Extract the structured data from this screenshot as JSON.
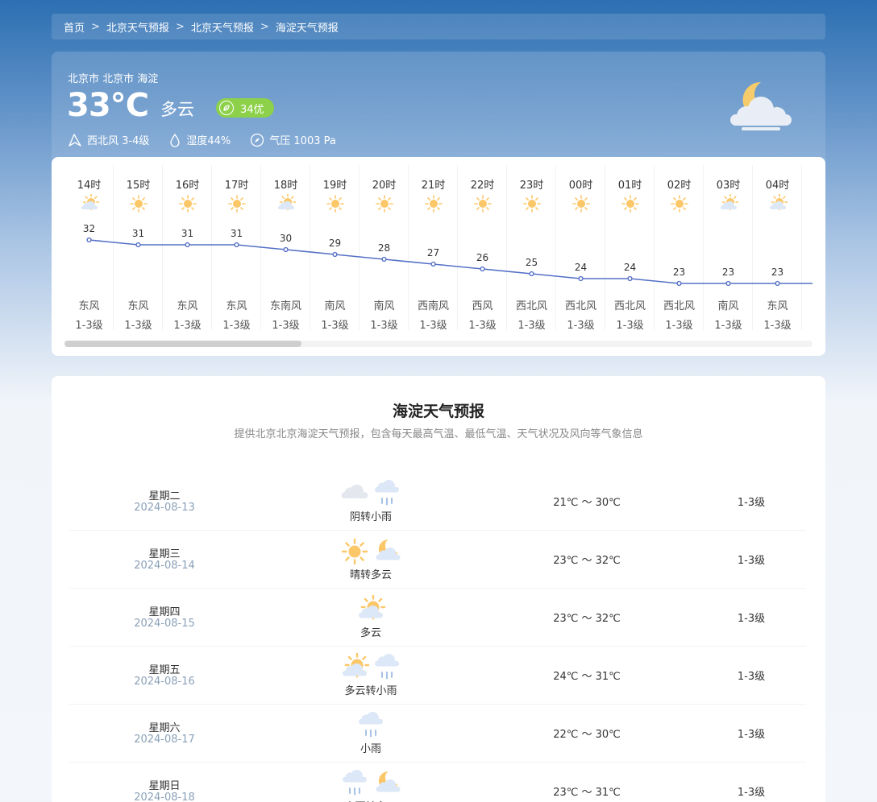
{
  "breadcrumb": [
    "首页",
    "北京天气预报",
    "北京天气预报",
    "海淀天气预报"
  ],
  "current": {
    "location": "北京市 北京市 海淀",
    "temperature": "33℃",
    "condition": "多云",
    "aqi": "34优",
    "wind": "西北风 3-4级",
    "humidity": "湿度44%",
    "pressure": "气压 1003 Pa",
    "icon": "moon-cloud-icon"
  },
  "hourly": [
    {
      "time": "14时",
      "icon": "sun-cloud",
      "temp": 32,
      "wind_dir": "东风",
      "wind_level": "1-3级"
    },
    {
      "time": "15时",
      "icon": "sun",
      "temp": 31,
      "wind_dir": "东风",
      "wind_level": "1-3级"
    },
    {
      "time": "16时",
      "icon": "sun",
      "temp": 31,
      "wind_dir": "东风",
      "wind_level": "1-3级"
    },
    {
      "time": "17时",
      "icon": "sun",
      "temp": 31,
      "wind_dir": "东风",
      "wind_level": "1-3级"
    },
    {
      "time": "18时",
      "icon": "sun-cloud",
      "temp": 30,
      "wind_dir": "东南风",
      "wind_level": "1-3级"
    },
    {
      "time": "19时",
      "icon": "sun",
      "temp": 29,
      "wind_dir": "南风",
      "wind_level": "1-3级"
    },
    {
      "time": "20时",
      "icon": "sun",
      "temp": 28,
      "wind_dir": "南风",
      "wind_level": "1-3级"
    },
    {
      "time": "21时",
      "icon": "sun",
      "temp": 27,
      "wind_dir": "西南风",
      "wind_level": "1-3级"
    },
    {
      "time": "22时",
      "icon": "sun",
      "temp": 26,
      "wind_dir": "西风",
      "wind_level": "1-3级"
    },
    {
      "time": "23时",
      "icon": "sun",
      "temp": 25,
      "wind_dir": "西北风",
      "wind_level": "1-3级"
    },
    {
      "time": "00时",
      "icon": "sun",
      "temp": 24,
      "wind_dir": "西北风",
      "wind_level": "1-3级"
    },
    {
      "time": "01时",
      "icon": "sun",
      "temp": 24,
      "wind_dir": "西北风",
      "wind_level": "1-3级"
    },
    {
      "time": "02时",
      "icon": "sun",
      "temp": 23,
      "wind_dir": "西北风",
      "wind_level": "1-3级"
    },
    {
      "time": "03时",
      "icon": "sun-cloud",
      "temp": 23,
      "wind_dir": "南风",
      "wind_level": "1-3级"
    },
    {
      "time": "04时",
      "icon": "sun-cloud",
      "temp": 23,
      "wind_dir": "东风",
      "wind_level": "1-3级"
    }
  ],
  "forecast": {
    "title": "海淀天气预报",
    "subtitle": "提供北京北京海淀天气预报，包含每天最高气温、最低气温、天气状况及风向等气象信息",
    "days": [
      {
        "week": "星期二",
        "date": "2024-08-13",
        "icons": [
          "cloud",
          "rain"
        ],
        "cond": "阴转小雨",
        "range": "21℃ ～ 30℃",
        "level": "1-3级"
      },
      {
        "week": "星期三",
        "date": "2024-08-14",
        "icons": [
          "sun",
          "moon-cloud"
        ],
        "cond": "晴转多云",
        "range": "23℃ ～ 32℃",
        "level": "1-3级"
      },
      {
        "week": "星期四",
        "date": "2024-08-15",
        "icons": [
          "sun-cloud"
        ],
        "cond": "多云",
        "range": "23℃ ～ 32℃",
        "level": "1-3级"
      },
      {
        "week": "星期五",
        "date": "2024-08-16",
        "icons": [
          "sun-cloud",
          "rain"
        ],
        "cond": "多云转小雨",
        "range": "24℃ ～ 31℃",
        "level": "1-3级"
      },
      {
        "week": "星期六",
        "date": "2024-08-17",
        "icons": [
          "rain"
        ],
        "cond": "小雨",
        "range": "22℃ ～ 30℃",
        "level": "1-3级"
      },
      {
        "week": "星期日",
        "date": "2024-08-18",
        "icons": [
          "rain",
          "moon-cloud"
        ],
        "cond": "小雨转多云",
        "range": "23℃ ～ 31℃",
        "level": "1-3级"
      }
    ]
  }
}
